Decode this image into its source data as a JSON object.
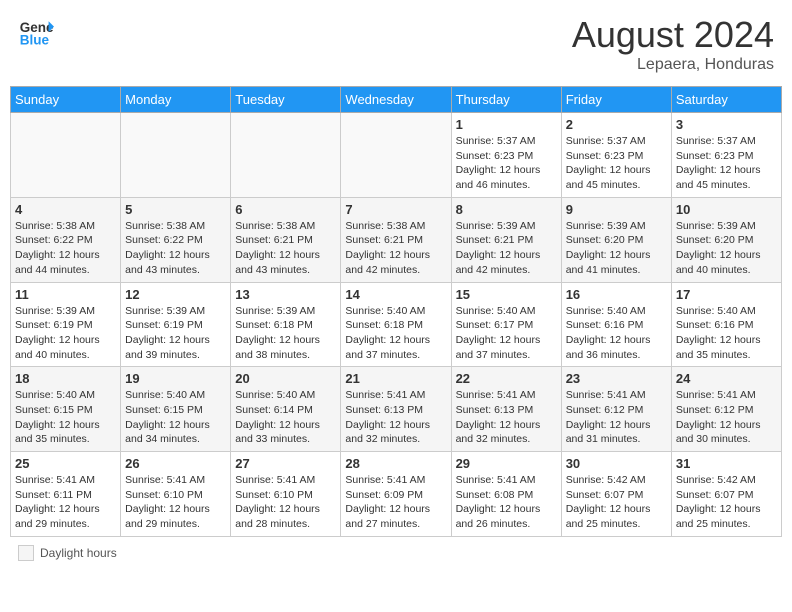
{
  "header": {
    "logo_line1": "General",
    "logo_line2": "Blue",
    "month_year": "August 2024",
    "location": "Lepaera, Honduras"
  },
  "legend": {
    "label": "Daylight hours"
  },
  "days_of_week": [
    "Sunday",
    "Monday",
    "Tuesday",
    "Wednesday",
    "Thursday",
    "Friday",
    "Saturday"
  ],
  "weeks": [
    [
      {
        "day": "",
        "info": ""
      },
      {
        "day": "",
        "info": ""
      },
      {
        "day": "",
        "info": ""
      },
      {
        "day": "",
        "info": ""
      },
      {
        "day": "1",
        "info": "Sunrise: 5:37 AM\nSunset: 6:23 PM\nDaylight: 12 hours\nand 46 minutes."
      },
      {
        "day": "2",
        "info": "Sunrise: 5:37 AM\nSunset: 6:23 PM\nDaylight: 12 hours\nand 45 minutes."
      },
      {
        "day": "3",
        "info": "Sunrise: 5:37 AM\nSunset: 6:23 PM\nDaylight: 12 hours\nand 45 minutes."
      }
    ],
    [
      {
        "day": "4",
        "info": "Sunrise: 5:38 AM\nSunset: 6:22 PM\nDaylight: 12 hours\nand 44 minutes."
      },
      {
        "day": "5",
        "info": "Sunrise: 5:38 AM\nSunset: 6:22 PM\nDaylight: 12 hours\nand 43 minutes."
      },
      {
        "day": "6",
        "info": "Sunrise: 5:38 AM\nSunset: 6:21 PM\nDaylight: 12 hours\nand 43 minutes."
      },
      {
        "day": "7",
        "info": "Sunrise: 5:38 AM\nSunset: 6:21 PM\nDaylight: 12 hours\nand 42 minutes."
      },
      {
        "day": "8",
        "info": "Sunrise: 5:39 AM\nSunset: 6:21 PM\nDaylight: 12 hours\nand 42 minutes."
      },
      {
        "day": "9",
        "info": "Sunrise: 5:39 AM\nSunset: 6:20 PM\nDaylight: 12 hours\nand 41 minutes."
      },
      {
        "day": "10",
        "info": "Sunrise: 5:39 AM\nSunset: 6:20 PM\nDaylight: 12 hours\nand 40 minutes."
      }
    ],
    [
      {
        "day": "11",
        "info": "Sunrise: 5:39 AM\nSunset: 6:19 PM\nDaylight: 12 hours\nand 40 minutes."
      },
      {
        "day": "12",
        "info": "Sunrise: 5:39 AM\nSunset: 6:19 PM\nDaylight: 12 hours\nand 39 minutes."
      },
      {
        "day": "13",
        "info": "Sunrise: 5:39 AM\nSunset: 6:18 PM\nDaylight: 12 hours\nand 38 minutes."
      },
      {
        "day": "14",
        "info": "Sunrise: 5:40 AM\nSunset: 6:18 PM\nDaylight: 12 hours\nand 37 minutes."
      },
      {
        "day": "15",
        "info": "Sunrise: 5:40 AM\nSunset: 6:17 PM\nDaylight: 12 hours\nand 37 minutes."
      },
      {
        "day": "16",
        "info": "Sunrise: 5:40 AM\nSunset: 6:16 PM\nDaylight: 12 hours\nand 36 minutes."
      },
      {
        "day": "17",
        "info": "Sunrise: 5:40 AM\nSunset: 6:16 PM\nDaylight: 12 hours\nand 35 minutes."
      }
    ],
    [
      {
        "day": "18",
        "info": "Sunrise: 5:40 AM\nSunset: 6:15 PM\nDaylight: 12 hours\nand 35 minutes."
      },
      {
        "day": "19",
        "info": "Sunrise: 5:40 AM\nSunset: 6:15 PM\nDaylight: 12 hours\nand 34 minutes."
      },
      {
        "day": "20",
        "info": "Sunrise: 5:40 AM\nSunset: 6:14 PM\nDaylight: 12 hours\nand 33 minutes."
      },
      {
        "day": "21",
        "info": "Sunrise: 5:41 AM\nSunset: 6:13 PM\nDaylight: 12 hours\nand 32 minutes."
      },
      {
        "day": "22",
        "info": "Sunrise: 5:41 AM\nSunset: 6:13 PM\nDaylight: 12 hours\nand 32 minutes."
      },
      {
        "day": "23",
        "info": "Sunrise: 5:41 AM\nSunset: 6:12 PM\nDaylight: 12 hours\nand 31 minutes."
      },
      {
        "day": "24",
        "info": "Sunrise: 5:41 AM\nSunset: 6:12 PM\nDaylight: 12 hours\nand 30 minutes."
      }
    ],
    [
      {
        "day": "25",
        "info": "Sunrise: 5:41 AM\nSunset: 6:11 PM\nDaylight: 12 hours\nand 29 minutes."
      },
      {
        "day": "26",
        "info": "Sunrise: 5:41 AM\nSunset: 6:10 PM\nDaylight: 12 hours\nand 29 minutes."
      },
      {
        "day": "27",
        "info": "Sunrise: 5:41 AM\nSunset: 6:10 PM\nDaylight: 12 hours\nand 28 minutes."
      },
      {
        "day": "28",
        "info": "Sunrise: 5:41 AM\nSunset: 6:09 PM\nDaylight: 12 hours\nand 27 minutes."
      },
      {
        "day": "29",
        "info": "Sunrise: 5:41 AM\nSunset: 6:08 PM\nDaylight: 12 hours\nand 26 minutes."
      },
      {
        "day": "30",
        "info": "Sunrise: 5:42 AM\nSunset: 6:07 PM\nDaylight: 12 hours\nand 25 minutes."
      },
      {
        "day": "31",
        "info": "Sunrise: 5:42 AM\nSunset: 6:07 PM\nDaylight: 12 hours\nand 25 minutes."
      }
    ]
  ]
}
